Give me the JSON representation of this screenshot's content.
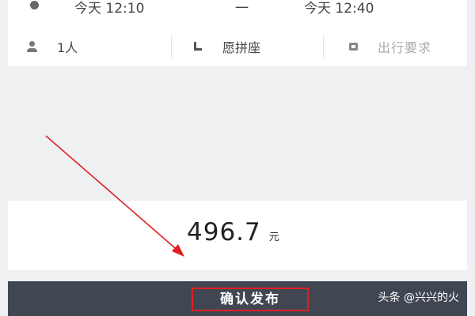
{
  "trip": {
    "start_time": "今天 12:10",
    "separator": "一",
    "end_time": "今天 12:40",
    "time_icon": "clock-icon",
    "passenger_count": "1人",
    "passenger_icon": "person-icon",
    "carpool_option": "愿拼座",
    "carpool_icon": "seat-icon",
    "requirements_placeholder": "出行要求",
    "requirements_icon": "note-icon"
  },
  "price": {
    "value": "496.7",
    "unit": "元"
  },
  "action": {
    "confirm_label": "确认发布"
  },
  "watermark": {
    "text": "头条 @兴兴的火"
  },
  "colors": {
    "background": "#eff0f2",
    "card": "#ffffff",
    "bottom_bar": "#404753",
    "annotation": "#e02020"
  }
}
